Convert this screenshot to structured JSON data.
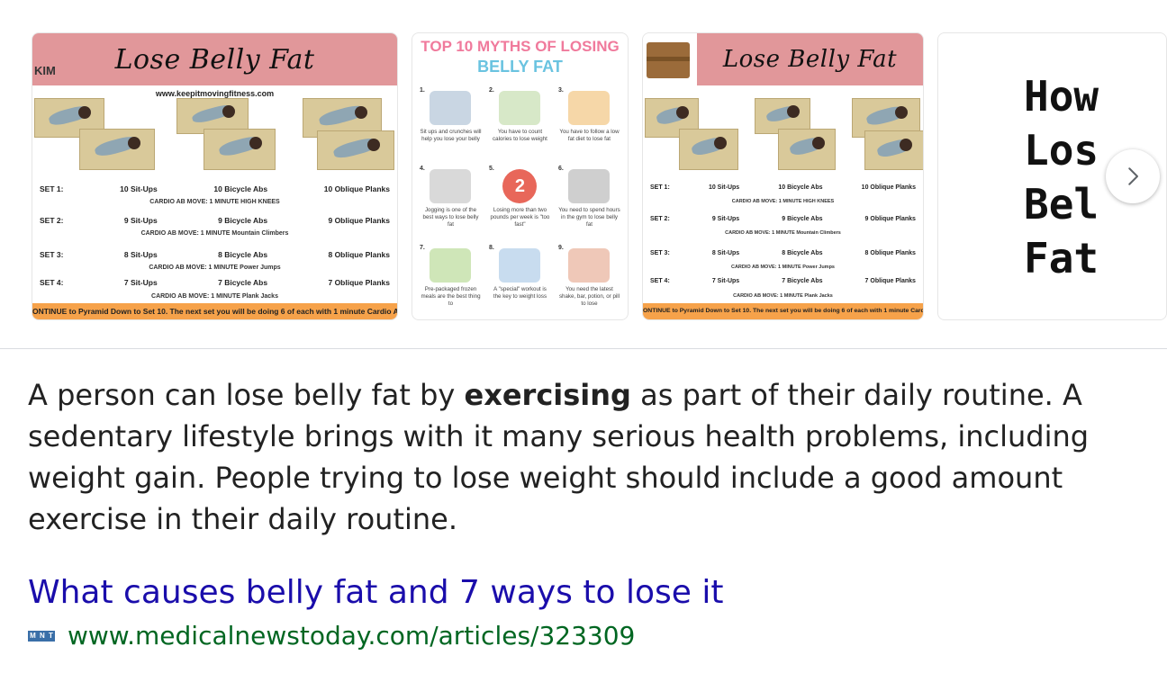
{
  "carousel": {
    "image1": {
      "banner": "Lose Belly Fat",
      "logo": "KIM",
      "url": "www.keepitmovingfitness.com",
      "sets": [
        {
          "label": "SET 1:",
          "a": "10 Sit-Ups",
          "b": "10 Bicycle Abs",
          "c": "10 Oblique Planks",
          "cardio": "CARDIO AB MOVE: 1 MINUTE  HIGH KNEES"
        },
        {
          "label": "SET 2:",
          "a": "9 Sit-Ups",
          "b": "9 Bicycle Abs",
          "c": "9 Oblique Planks",
          "cardio": "CARDIO AB MOVE: 1 MINUTE  Mountain Climbers"
        },
        {
          "label": "SET 3:",
          "a": "8 Sit-Ups",
          "b": "8 Bicycle Abs",
          "c": "8 Oblique Planks",
          "cardio": "CARDIO AB MOVE: 1 MINUTE  Power Jumps"
        },
        {
          "label": "SET 4:",
          "a": "7 Sit-Ups",
          "b": "7 Bicycle Abs",
          "c": "7 Oblique Planks",
          "cardio": "CARDIO AB MOVE: 1 MINUTE  Plank Jacks"
        }
      ],
      "footer": "ONTINUE to Pyramid Down to Set 10. The next set you will be doing 6 of each with 1 minute Cardio Ab"
    },
    "image2": {
      "title_line1": "TOP 10 MYTHS OF LOSING",
      "title_line2": "BELLY FAT",
      "cells": [
        {
          "num": "1.",
          "caption": "Sit ups and crunches will help you lose your belly",
          "color": "#c9d6e3"
        },
        {
          "num": "2.",
          "caption": "You have to count calories to lose weight",
          "color": "#d7e8c8"
        },
        {
          "num": "3.",
          "caption": "You have to follow a low fat diet to lose fat",
          "color": "#f6d7a8"
        },
        {
          "num": "4.",
          "caption": "Jogging is one of the best ways to lose belly fat",
          "color": "#d9d9d9"
        },
        {
          "num": "5.",
          "caption": "Losing more than two pounds per week is \"too fast\"",
          "color": "#e8675a"
        },
        {
          "num": "6.",
          "caption": "You need to spend hours in the gym to lose belly fat",
          "color": "#cfcfcf"
        },
        {
          "num": "7.",
          "caption": "Pre-packaged frozen meals are the best thing to",
          "color": "#cfe6b8"
        },
        {
          "num": "8.",
          "caption": "A \"special\" workout is the key to weight loss",
          "color": "#c8dcef"
        },
        {
          "num": "9.",
          "caption": "You need the latest shake, bar, potion, or pill to lose",
          "color": "#efc8b8"
        }
      ],
      "badge": "2"
    },
    "image3": {
      "banner": "Lose Belly Fat",
      "sets": [
        {
          "label": "SET 1:",
          "a": "10 Sit-Ups",
          "b": "10 Bicycle Abs",
          "c": "10 Oblique Planks",
          "cardio": "CARDIO AB MOVE: 1 MINUTE  HIGH KNEES"
        },
        {
          "label": "SET 2:",
          "a": "9 Sit-Ups",
          "b": "9 Bicycle Abs",
          "c": "9 Oblique Planks",
          "cardio": "CARDIO AB MOVE: 1 MINUTE  Mountain Climbers"
        },
        {
          "label": "SET 3:",
          "a": "8 Sit-Ups",
          "b": "8 Bicycle Abs",
          "c": "8 Oblique Planks",
          "cardio": "CARDIO AB MOVE: 1 MINUTE  Power Jumps"
        },
        {
          "label": "SET 4:",
          "a": "7 Sit-Ups",
          "b": "7 Bicycle Abs",
          "c": "7 Oblique Planks",
          "cardio": "CARDIO AB MOVE: 1 MINUTE  Plank Jacks"
        }
      ],
      "footer": "ONTINUE to Pyramid Down to Set 10. The next set you will be doing 6 of each with 1 minute Cardio Ab"
    },
    "image4": {
      "lines": [
        "How",
        "Los",
        "Bel",
        "Fat"
      ]
    },
    "next_icon": "chevron-right-icon"
  },
  "snippet": {
    "before": "A person can lose belly fat by ",
    "bold": "exercising",
    "after": " as part of their daily routine. A sedentary lifestyle brings with it many serious health problems, including weight gain. People trying to lose weight should include a good amount exercise in their daily routine."
  },
  "result": {
    "title": "What causes belly fat and 7 ways to lose it",
    "favicon_text": [
      "M",
      "N",
      "T"
    ],
    "url": "www.medicalnewstoday.com/articles/323309"
  },
  "colors": {
    "link": "#1a0dab",
    "url_green": "#006621",
    "banner_pink": "#e1979a",
    "footer_orange": "#f6a24a"
  }
}
